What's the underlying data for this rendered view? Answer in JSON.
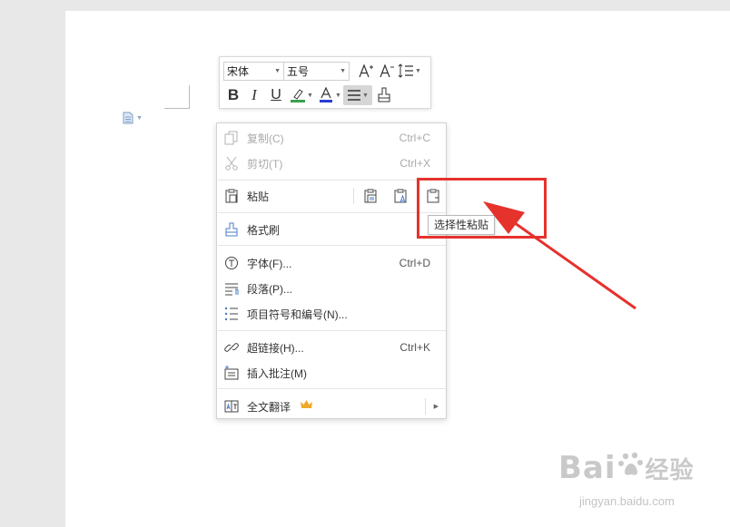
{
  "toolbar": {
    "font_name": "宋体",
    "font_size": "五号"
  },
  "context_menu": {
    "copy": {
      "label": "复制(C)",
      "shortcut": "Ctrl+C"
    },
    "cut": {
      "label": "剪切(T)",
      "shortcut": "Ctrl+X"
    },
    "paste": {
      "label": "粘贴"
    },
    "format_painter": {
      "label": "格式刷"
    },
    "font": {
      "label": "字体(F)...",
      "shortcut": "Ctrl+D"
    },
    "paragraph": {
      "label": "段落(P)..."
    },
    "bullets": {
      "label": "项目符号和编号(N)..."
    },
    "hyperlink": {
      "label": "超链接(H)...",
      "shortcut": "Ctrl+K"
    },
    "comment": {
      "label": "插入批注(M)"
    },
    "translate": {
      "label": "全文翻译"
    }
  },
  "tooltip": "选择性粘贴",
  "watermark": {
    "brand": "Bai",
    "brand_suffix": "经验",
    "url": "jingyan.baidu.com"
  },
  "colors": {
    "highlight_red": "#e5322d",
    "font_color_blue": "#2b3bd6",
    "highlighter_green": "#3aa14a",
    "crown_gold": "#f0a92a"
  }
}
